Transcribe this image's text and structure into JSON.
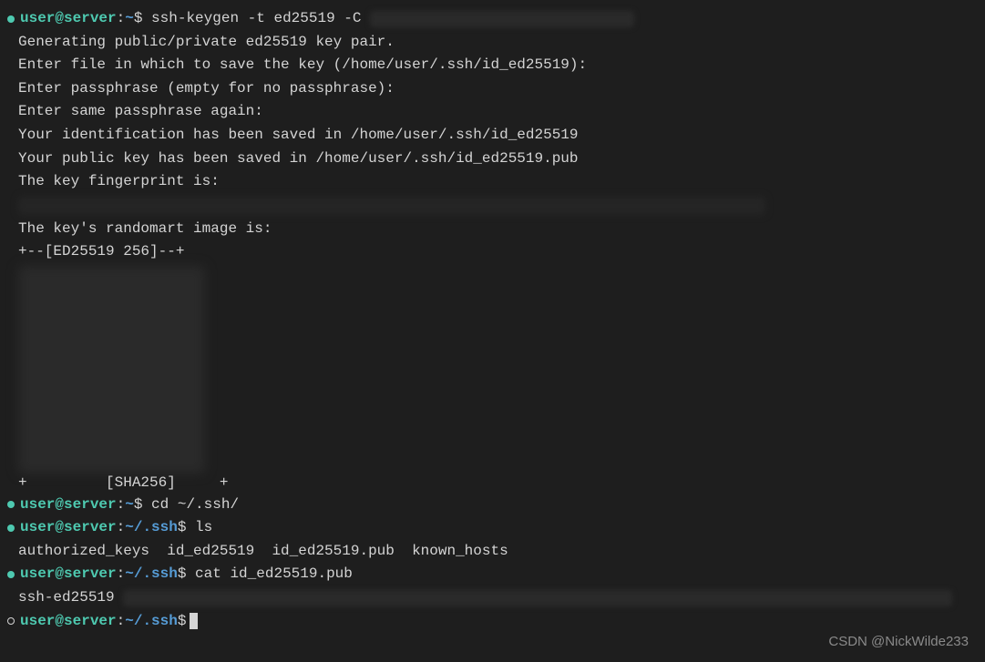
{
  "prompt1": {
    "user": "user@server",
    "path": "~",
    "command": "ssh-keygen -t ed25519 -C"
  },
  "output": {
    "line1": "Generating public/private ed25519 key pair.",
    "line2": "Enter file in which to save the key (/home/user/.ssh/id_ed25519):",
    "line3": "Enter passphrase (empty for no passphrase):",
    "line4": "Enter same passphrase again:",
    "line5": "Your identification has been saved in /home/user/.ssh/id_ed25519",
    "line6": "Your public key has been saved in /home/user/.ssh/id_ed25519.pub",
    "line7": "The key fingerprint is:",
    "line8": "The key's randomart image is:",
    "line9": "+--[ED25519 256]--+",
    "line10": "     [SHA256]     "
  },
  "prompt2": {
    "user": "user@server",
    "path": "~",
    "command": "cd ~/.ssh/"
  },
  "prompt3": {
    "user": "user@server",
    "path": "~/.ssh",
    "command": "ls"
  },
  "lsOutput": "authorized_keys  id_ed25519  id_ed25519.pub  known_hosts",
  "prompt4": {
    "user": "user@server",
    "path": "~/.ssh",
    "command": "cat id_ed25519.pub"
  },
  "catOutput": "ssh-ed25519 ",
  "prompt5": {
    "user": "user@server",
    "path": "~/.ssh",
    "command": ""
  },
  "watermark": "CSDN @NickWilde233"
}
